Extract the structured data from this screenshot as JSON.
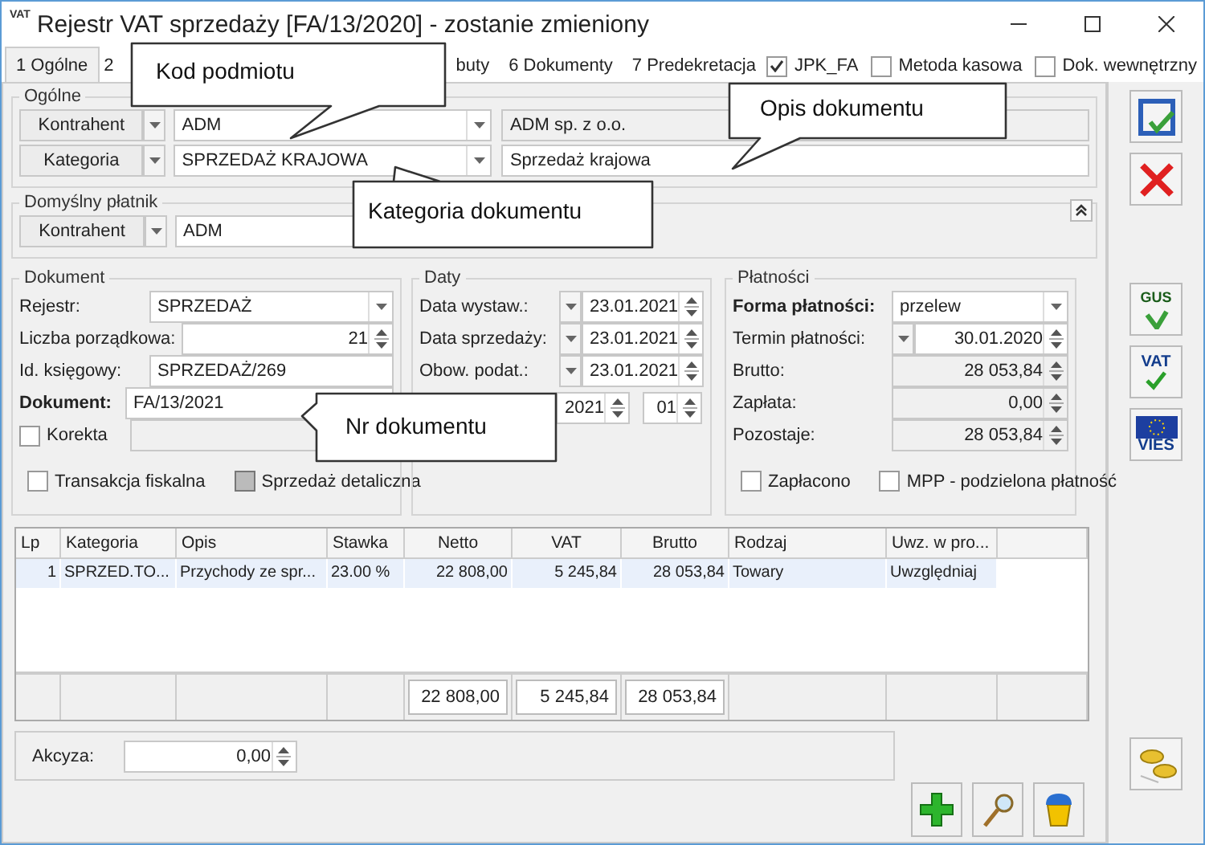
{
  "window": {
    "icon_label": "VAT",
    "title": "Rejestr VAT sprzedaży [FA/13/2020] - zostanie zmieniony"
  },
  "tabs": [
    {
      "label": "1 Ogólne",
      "selected": true
    },
    {
      "label": "2",
      "selected": false
    },
    {
      "label": "buty",
      "selected": false
    },
    {
      "label": "6 Dokumenty",
      "selected": false
    },
    {
      "label": "7 Predekretacja",
      "selected": false
    }
  ],
  "header_checks": [
    {
      "label": "JPK_FA",
      "checked": true
    },
    {
      "label": "Metoda kasowa",
      "checked": false
    },
    {
      "label": "Dok. wewnętrzny",
      "checked": false
    }
  ],
  "general": {
    "title": "Ogólne",
    "rows": [
      {
        "button": "Kontrahent",
        "code": "ADM",
        "name": "ADM sp. z o.o.",
        "disabled": true
      },
      {
        "button": "Kategoria",
        "code": "SPRZEDAŻ KRAJOWA",
        "name": "Sprzedaż krajowa",
        "disabled": false
      }
    ]
  },
  "payer": {
    "title": "Domyślny płatnik",
    "button": "Kontrahent",
    "code": "ADM"
  },
  "document": {
    "title": "Dokument",
    "fields": [
      {
        "label": "Rejestr:",
        "value": "SPRZEDAŻ",
        "kind": "combo",
        "emphasis": false
      },
      {
        "label": "Liczba porządkowa:",
        "value": "21",
        "kind": "spin",
        "emphasis": false
      },
      {
        "label": "Id. księgowy:",
        "value": "SPRZEDAŻ/269",
        "kind": "text",
        "emphasis": false
      },
      {
        "label": "Dokument:",
        "value": "FA/13/2021",
        "kind": "text",
        "emphasis": true
      }
    ],
    "correction": {
      "label": "Korekta",
      "checked": false
    },
    "checks": [
      {
        "label": "Transakcja fiskalna",
        "checked": false,
        "disabled": false
      },
      {
        "label": "Sprzedaż detaliczna",
        "checked": false,
        "disabled": true
      }
    ]
  },
  "dates": {
    "title": "Daty",
    "rows": [
      {
        "label": "Data wystaw.:",
        "value": "23.01.2021"
      },
      {
        "label": "Data sprzedaży:",
        "value": "23.01.2021"
      },
      {
        "label": "Obow. podat.:",
        "value": "23.01.2021"
      }
    ],
    "period": {
      "year": "2021",
      "month": "01"
    }
  },
  "payments": {
    "title": "Płatności",
    "rows": [
      {
        "label": "Forma płatności:",
        "value": "przelew",
        "kind": "combo",
        "emphasis": true
      },
      {
        "label": "Termin płatności:",
        "value": "30.01.2020",
        "kind": "date",
        "emphasis": false
      },
      {
        "label": "Brutto:",
        "value": "28 053,84",
        "kind": "amount",
        "emphasis": false
      },
      {
        "label": "Zapłata:",
        "value": "0,00",
        "kind": "amount",
        "emphasis": false
      },
      {
        "label": "Pozostaje:",
        "value": "28 053,84",
        "kind": "amount",
        "emphasis": false
      }
    ],
    "checks": [
      {
        "label": "Zapłacono",
        "checked": false
      },
      {
        "label": "MPP - podzielona płatność",
        "checked": false
      }
    ]
  },
  "table": {
    "columns": [
      "Lp",
      "Kategoria",
      "Opis",
      "Stawka",
      "Netto",
      "VAT",
      "Brutto",
      "Rodzaj",
      "Uwz. w pro..."
    ],
    "rows": [
      {
        "selected": true,
        "cells": [
          "1",
          "SPRZED.TO...",
          "Przychody ze spr...",
          "23.00 %",
          "22 808,00",
          "5 245,84",
          "28 053,84",
          "Towary",
          "Uwzględniaj"
        ]
      }
    ],
    "totals": [
      "22 808,00",
      "5 245,84",
      "28 053,84"
    ]
  },
  "excise": {
    "label": "Akcyza:",
    "value": "0,00"
  },
  "side_buttons": [
    {
      "kind": "save"
    },
    {
      "kind": "cancel"
    },
    {
      "kind": "gus",
      "label": "GUS"
    },
    {
      "kind": "vat",
      "label": "VAT"
    },
    {
      "kind": "vies",
      "label": "VIES"
    },
    {
      "kind": "coins"
    }
  ],
  "bottom_buttons": [
    {
      "kind": "add"
    },
    {
      "kind": "preview"
    },
    {
      "kind": "delete"
    }
  ],
  "callouts": [
    {
      "text": "Kod podmiotu"
    },
    {
      "text": "Opis dokumentu"
    },
    {
      "text": "Kategoria dokumentu"
    },
    {
      "text": "Nr dokumentu"
    }
  ]
}
